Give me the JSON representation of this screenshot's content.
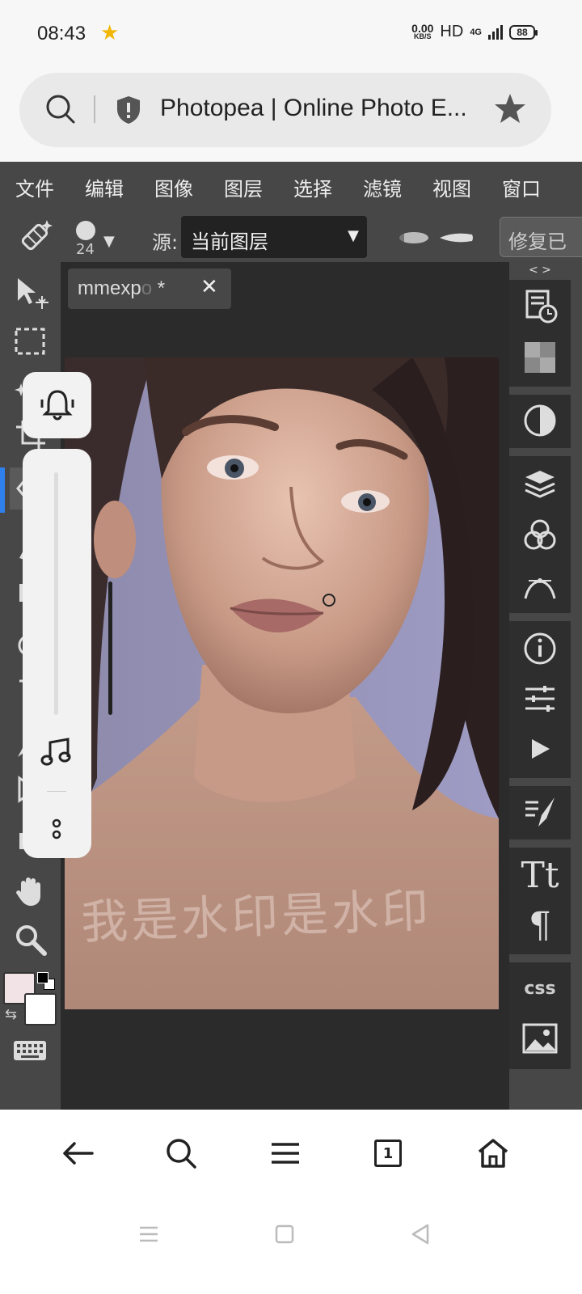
{
  "status_bar": {
    "time": "08:43",
    "net_speed_value": "0.00",
    "net_speed_unit": "KB/S",
    "hd_label": "HD",
    "network_type": "4G",
    "battery": "88"
  },
  "browser": {
    "url_title": "Photopea | Online Photo E..."
  },
  "menubar": {
    "items": [
      "文件",
      "编辑",
      "图像",
      "图层",
      "选择",
      "滤镜",
      "视图",
      "窗口"
    ]
  },
  "options_bar": {
    "brush_size": "24",
    "source_label": "源:",
    "source_value": "当前图层",
    "repair_button": "修复已"
  },
  "document_tab": {
    "name_visible": "mmexp",
    "name_faded": "o",
    "modified_marker": " *"
  },
  "canvas": {
    "watermark": "我是水印是水印"
  },
  "right_panel": {
    "toggle_label": "< >",
    "css_label": "css"
  },
  "volume": {
    "level": 0.55
  },
  "browser_nav": {
    "tab_count": "1"
  },
  "colors": {
    "app_background": "#474747",
    "workspace_background": "#2b2b2b",
    "foreground_color": "#f2e4e6",
    "background_color": "#ffffff"
  }
}
